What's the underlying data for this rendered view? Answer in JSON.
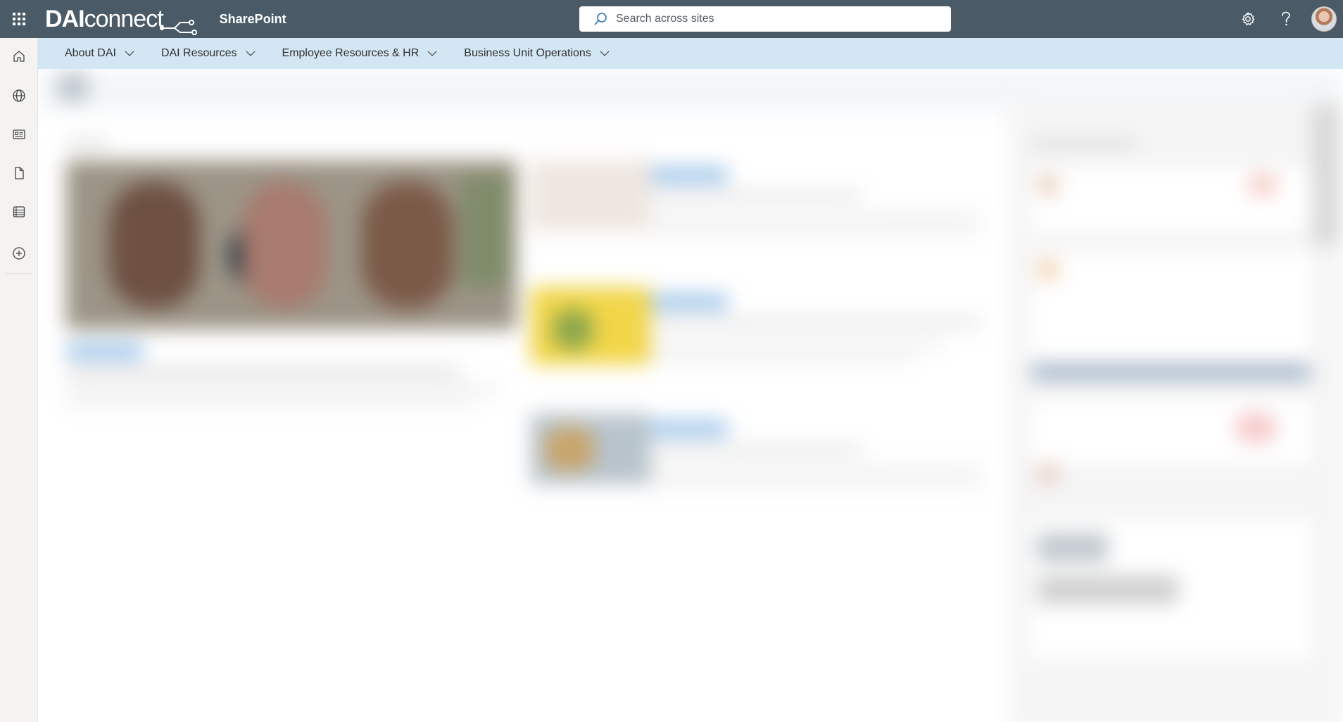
{
  "suite_bar": {
    "logo": {
      "bold": "DAI",
      "light": "connect"
    },
    "app_name": "SharePoint",
    "search": {
      "placeholder": "Search across sites"
    },
    "icons": [
      "waffle-icon",
      "settings-icon",
      "help-icon",
      "avatar"
    ]
  },
  "hub_nav": {
    "items": [
      {
        "label": "About DAI"
      },
      {
        "label": "DAI Resources"
      },
      {
        "label": "Employee Resources & HR"
      },
      {
        "label": "Business Unit Operations"
      }
    ]
  },
  "left_rail": {
    "icons": [
      "home-icon",
      "globe-icon",
      "news-icon",
      "file-icon",
      "list-icon",
      "create-icon"
    ]
  },
  "content": {
    "state": "blurred-loading"
  },
  "colors": {
    "suite_bar_bg": "#4a5b67",
    "hub_nav_bg": "#d3e6f3",
    "left_rail_bg": "#f4f3f2",
    "accent": "#5b8fc9"
  }
}
